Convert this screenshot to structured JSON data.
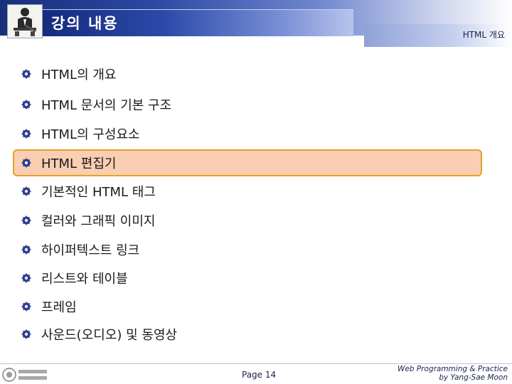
{
  "header": {
    "title": "강의 내용",
    "section_label": "HTML 개요"
  },
  "items": [
    {
      "label": "HTML의 개요"
    },
    {
      "label": "HTML 문서의 기본 구조"
    },
    {
      "label": "HTML의 구성요소"
    },
    {
      "label": "HTML 편집기",
      "highlighted": true
    },
    {
      "label": "기본적인 HTML 태그"
    },
    {
      "label": "컬러와 그래픽 이미지"
    },
    {
      "label": "하이퍼텍스트 링크"
    },
    {
      "label": "리스트와 테이블"
    },
    {
      "label": "프레임"
    },
    {
      "label": "사운드(오디오) 및 동영상"
    }
  ],
  "footer": {
    "page": "Page 14",
    "credit_line1": "Web Programming & Practice",
    "credit_line2": "by Yang-Sae Moon"
  },
  "colors": {
    "title_bar": "#2c48a3",
    "highlight_fill": "#f9ceb2",
    "highlight_border": "#e4a028"
  },
  "icons": [
    "teacher-logo-icon",
    "gear-bullet-icon",
    "university-logo-icon"
  ]
}
